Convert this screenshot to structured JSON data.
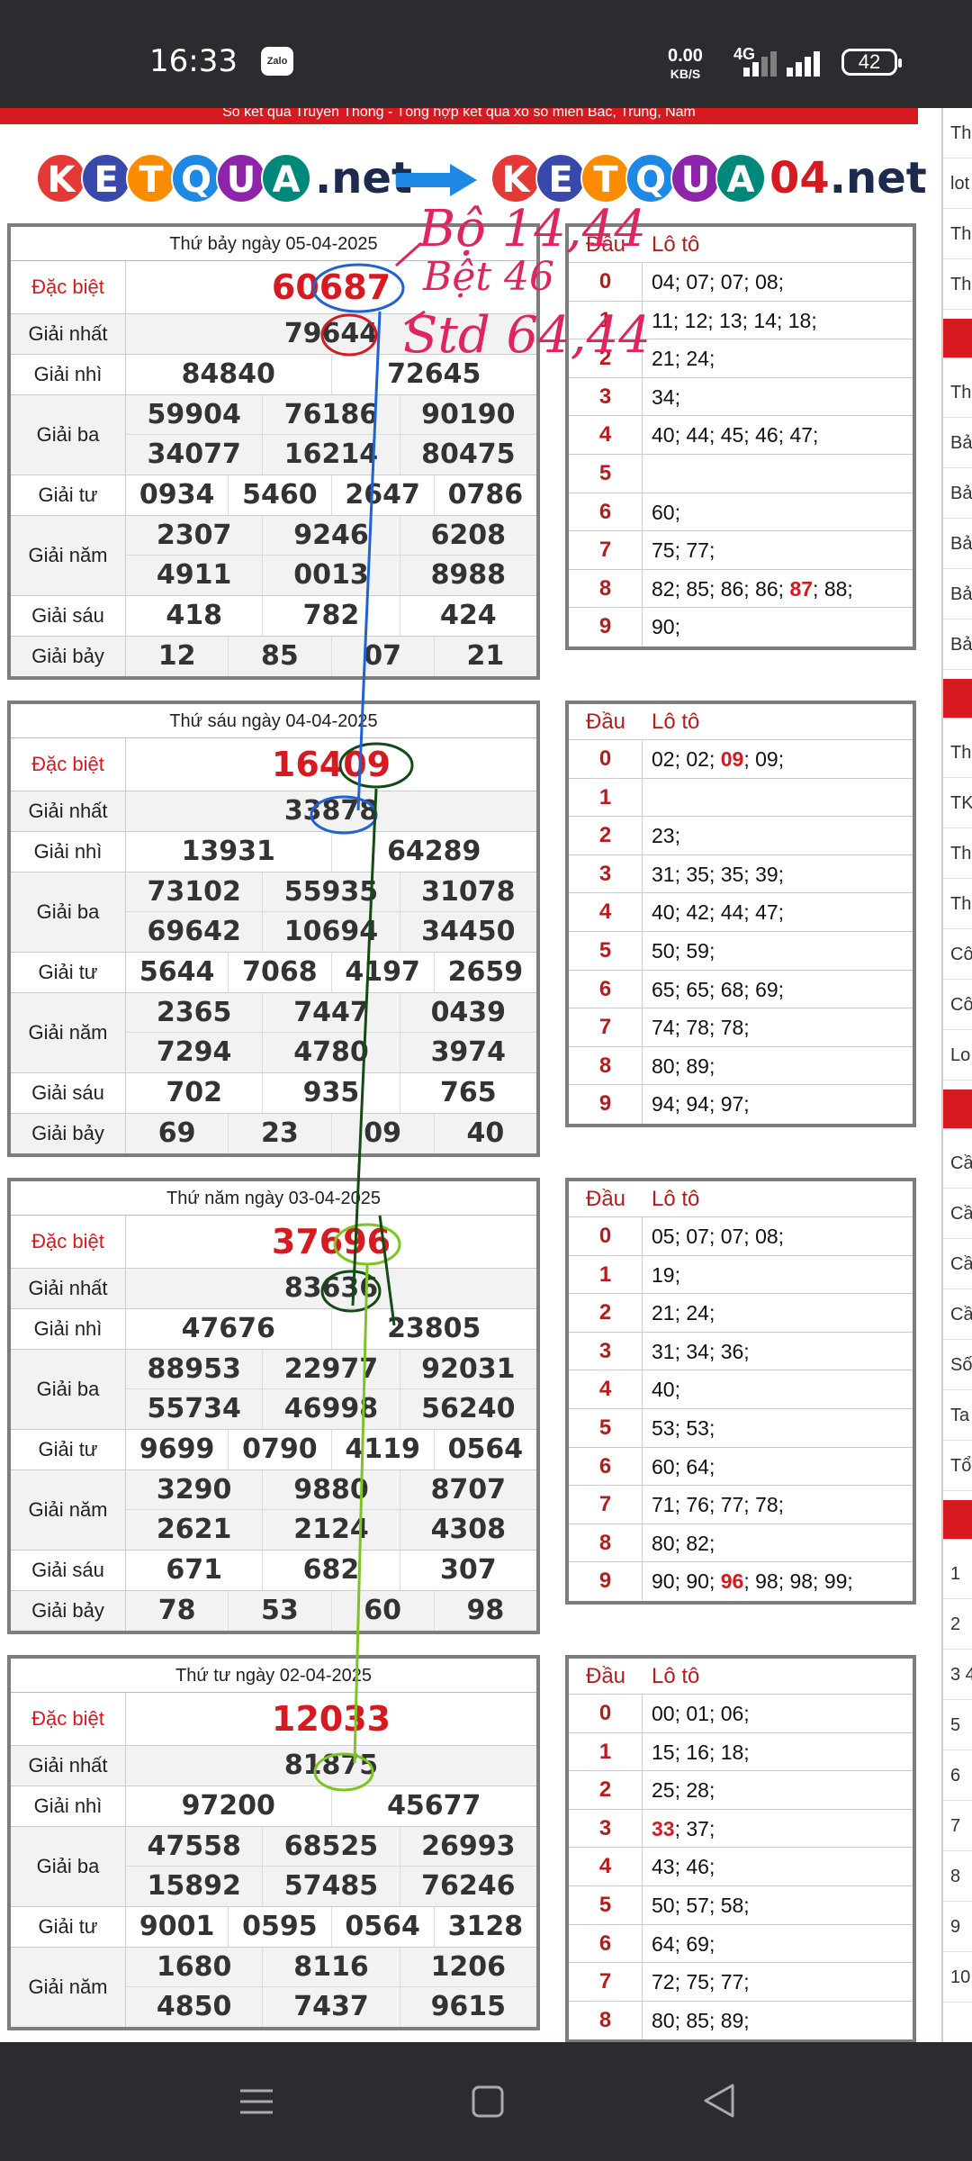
{
  "status_bar": {
    "time": "16:33",
    "zalo": "Zalo",
    "net_speed": "0.00",
    "net_unit": "KB/S",
    "network": "4G",
    "battery": "42"
  },
  "page": {
    "top_banner": "Sổ kết quả Truyền Thống - Tổng hợp kết quả xổ số miền Bắc, Trung, Nam",
    "logo_left": {
      "letters": [
        "K",
        "E",
        "T",
        "Q",
        "U",
        "A"
      ],
      "suffix": ".net"
    },
    "logo_right": {
      "letters": [
        "K",
        "E",
        "T",
        "Q",
        "U",
        "A"
      ],
      "number": "04",
      "suffix": ".net"
    },
    "colors": {
      "red": "#d71920",
      "ball_colors": [
        "#e53935",
        "#3949ab",
        "#fb8c00",
        "#1e88e5",
        "#8e24aa",
        "#00897b"
      ]
    }
  },
  "labels": {
    "db": "Đặc biệt",
    "g1": "Giải nhất",
    "g2": "Giải nhì",
    "g3": "Giải ba",
    "g4": "Giải tư",
    "g5": "Giải năm",
    "g6": "Giải sáu",
    "g7": "Giải bảy",
    "dau": "Đầu",
    "loto": "Lô tô"
  },
  "results": [
    {
      "date": "Thứ bảy ngày 05-04-2025",
      "db": "60687",
      "g1": "79644",
      "g2": [
        "84840",
        "72645"
      ],
      "g3": [
        [
          "59904",
          "76186",
          "90190"
        ],
        [
          "34077",
          "16214",
          "80475"
        ]
      ],
      "g4": [
        "0934",
        "5460",
        "2647",
        "0786"
      ],
      "g5": [
        [
          "2307",
          "9246",
          "6208"
        ],
        [
          "4911",
          "0013",
          "8988"
        ]
      ],
      "g6": [
        "418",
        "782",
        "424"
      ],
      "g7": [
        "12",
        "85",
        "07",
        "21"
      ],
      "loto": [
        {
          "d": "0",
          "v": "04; 07; 07; 08;"
        },
        {
          "d": "1",
          "v": "11; 12; 13; 14; 18;"
        },
        {
          "d": "2",
          "v": "21; 24;"
        },
        {
          "d": "3",
          "v": "34;"
        },
        {
          "d": "4",
          "v": "40; 44; 45; 46; 47;"
        },
        {
          "d": "5",
          "v": ""
        },
        {
          "d": "6",
          "v": "60;"
        },
        {
          "d": "7",
          "v": "75; 77;"
        },
        {
          "d": "8",
          "v": "82; 85; 86; 86; ",
          "hl": "87",
          "after": "; 88;"
        },
        {
          "d": "9",
          "v": "90;"
        }
      ]
    },
    {
      "date": "Thứ sáu ngày 04-04-2025",
      "db": "16409",
      "g1": "33878",
      "g2": [
        "13931",
        "64289"
      ],
      "g3": [
        [
          "73102",
          "55935",
          "31078"
        ],
        [
          "69642",
          "10694",
          "34450"
        ]
      ],
      "g4": [
        "5644",
        "7068",
        "4197",
        "2659"
      ],
      "g5": [
        [
          "2365",
          "7447",
          "0439"
        ],
        [
          "7294",
          "4780",
          "3974"
        ]
      ],
      "g6": [
        "702",
        "935",
        "765"
      ],
      "g7": [
        "69",
        "23",
        "09",
        "40"
      ],
      "loto": [
        {
          "d": "0",
          "v": "02; 02; ",
          "hl": "09",
          "after": "; 09;"
        },
        {
          "d": "1",
          "v": ""
        },
        {
          "d": "2",
          "v": "23;"
        },
        {
          "d": "3",
          "v": "31; 35; 35; 39;"
        },
        {
          "d": "4",
          "v": "40; 42; 44; 47;"
        },
        {
          "d": "5",
          "v": "50; 59;"
        },
        {
          "d": "6",
          "v": "65; 65; 68; 69;"
        },
        {
          "d": "7",
          "v": "74; 78; 78;"
        },
        {
          "d": "8",
          "v": "80; 89;"
        },
        {
          "d": "9",
          "v": "94; 94; 97;"
        }
      ]
    },
    {
      "date": "Thứ năm ngày 03-04-2025",
      "db": "37696",
      "g1": "83636",
      "g2": [
        "47676",
        "23805"
      ],
      "g3": [
        [
          "88953",
          "22977",
          "92031"
        ],
        [
          "55734",
          "46998",
          "56240"
        ]
      ],
      "g4": [
        "9699",
        "0790",
        "4119",
        "0564"
      ],
      "g5": [
        [
          "3290",
          "9880",
          "8707"
        ],
        [
          "2621",
          "2124",
          "4308"
        ]
      ],
      "g6": [
        "671",
        "682",
        "307"
      ],
      "g7": [
        "78",
        "53",
        "60",
        "98"
      ],
      "loto": [
        {
          "d": "0",
          "v": "05; 07; 07; 08;"
        },
        {
          "d": "1",
          "v": "19;"
        },
        {
          "d": "2",
          "v": "21; 24;"
        },
        {
          "d": "3",
          "v": "31; 34; 36;"
        },
        {
          "d": "4",
          "v": "40;"
        },
        {
          "d": "5",
          "v": "53; 53;"
        },
        {
          "d": "6",
          "v": "60; 64;"
        },
        {
          "d": "7",
          "v": "71; 76; 77; 78;"
        },
        {
          "d": "8",
          "v": "80; 82;"
        },
        {
          "d": "9",
          "v": "90; 90; ",
          "hl": "96",
          "after": "; 98; 98; 99;"
        }
      ]
    },
    {
      "date": "Thứ tư ngày 02-04-2025",
      "db": "12033",
      "g1": "81875",
      "g2": [
        "97200",
        "45677"
      ],
      "g3": [
        [
          "47558",
          "68525",
          "26993"
        ],
        [
          "15892",
          "57485",
          "76246"
        ]
      ],
      "g4": [
        "9001",
        "0595",
        "0564",
        "3128"
      ],
      "g5": [
        [
          "1680",
          "8116",
          "1206"
        ],
        [
          "4850",
          "7437",
          "9615"
        ]
      ],
      "g6": [],
      "g7": [],
      "loto": [
        {
          "d": "0",
          "v": "00; 01; 06;"
        },
        {
          "d": "1",
          "v": "15; 16; 18;"
        },
        {
          "d": "2",
          "v": "25; 28;"
        },
        {
          "d": "3",
          "v": "",
          "hl": "33",
          "after": "; 37;"
        },
        {
          "d": "4",
          "v": "43; 46;"
        },
        {
          "d": "5",
          "v": "50; 57; 58;"
        },
        {
          "d": "6",
          "v": "64; 69;"
        },
        {
          "d": "7",
          "v": "72; 75; 77;"
        },
        {
          "d": "8",
          "v": "80; 85; 89;"
        }
      ]
    }
  ],
  "sidebar": [
    "Th",
    "lot",
    "Th",
    "Th the",
    "",
    "Th",
    "Bả",
    "Bả",
    "Bả",
    "Bả",
    "Bả",
    "",
    "Th",
    "TK",
    "Th",
    "Th",
    "Cô",
    "Cô VII",
    "Lo",
    "",
    "Cầ",
    "Cầ",
    "Cầ",
    "Cầ",
    "Số",
    "Ta",
    "Tổ",
    "",
    "1",
    "2",
    "3 4",
    "5",
    "6",
    "7",
    "8",
    "9",
    "10"
  ],
  "annotations": {
    "line1": "Bộ 14,44",
    "line2": "Bệt 46",
    "line3": "Std 64,44"
  }
}
